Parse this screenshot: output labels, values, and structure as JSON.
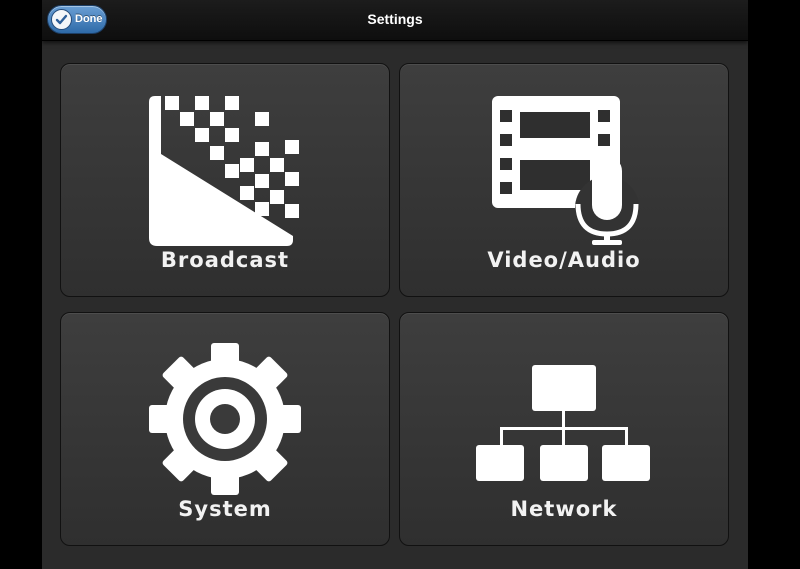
{
  "header": {
    "title": "Settings",
    "done_label": "Done"
  },
  "tiles": [
    {
      "label": "Broadcast",
      "icon": "broadcast-icon"
    },
    {
      "label": "Video/Audio",
      "icon": "video-audio-icon"
    },
    {
      "label": "System",
      "icon": "gear-icon"
    },
    {
      "label": "Network",
      "icon": "network-icon"
    }
  ],
  "colors": {
    "background": "#2b2b2b",
    "tile": "#383838",
    "accent": "#4a83c0",
    "icon": "#ffffff"
  }
}
